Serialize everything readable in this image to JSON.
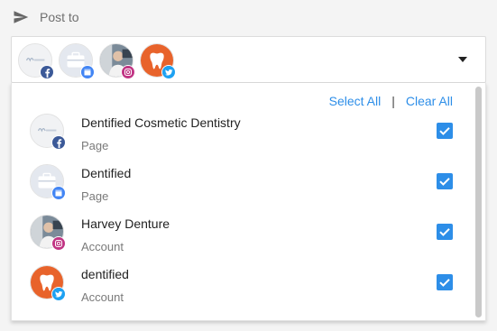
{
  "header": {
    "icon": "send-icon",
    "label": "Post to"
  },
  "selected_profiles": [
    {
      "avatar": "dentified-logo",
      "network": "facebook"
    },
    {
      "avatar": "briefcase",
      "network": "google-my-business"
    },
    {
      "avatar": "person-photo",
      "network": "instagram"
    },
    {
      "avatar": "tooth-logo",
      "network": "twitter"
    }
  ],
  "panel": {
    "select_all": "Select All",
    "separator": "|",
    "clear_all": "Clear All"
  },
  "profiles": [
    {
      "name": "Dentified Cosmetic Dentistry",
      "type": "Page",
      "network": "facebook",
      "checked": true
    },
    {
      "name": "Dentified",
      "type": "Page",
      "network": "google-my-business",
      "checked": true
    },
    {
      "name": "Harvey Denture",
      "type": "Account",
      "network": "instagram",
      "checked": true
    },
    {
      "name": "dentified",
      "type": "Account",
      "network": "twitter",
      "checked": true
    }
  ],
  "colors": {
    "accent": "#2d8ee8",
    "facebook": "#3b5998",
    "gmb": "#4285f4",
    "instagram": "#c13584",
    "twitter": "#1da1f2",
    "tooth_bg": "#e8632b"
  }
}
